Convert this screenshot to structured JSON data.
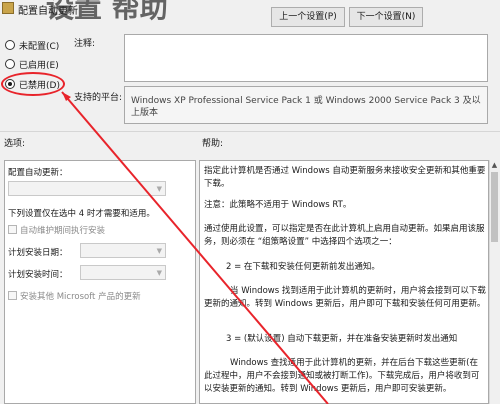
{
  "window": {
    "title": "配置自动更新",
    "title_big": "设置  帮助"
  },
  "nav": {
    "prev": "上一个设置(P)",
    "next": "下一个设置(N)"
  },
  "state": {
    "options": [
      {
        "label": "未配置(C)",
        "checked": false
      },
      {
        "label": "已启用(E)",
        "checked": false
      },
      {
        "label": "已禁用(D)",
        "checked": true
      }
    ]
  },
  "comment": {
    "label": "注释:",
    "value": ""
  },
  "supported": {
    "label": "支持的平台:",
    "value": "Windows XP Professional Service Pack 1 或 Windows 2000 Service Pack 3 及以上版本"
  },
  "options_section": {
    "heading": "选项:",
    "configure_label": "配置自动更新：",
    "configure_value": "",
    "note": "下列设置仅在选中 4 时才需要和适用。",
    "maintenance_cb": "自动维护期间执行安装",
    "schedule_day_label": "计划安装日期：",
    "schedule_time_label": "计划安装时间：",
    "other_products_cb": "安装其他 Microsoft 产品的更新"
  },
  "help_section": {
    "heading": "帮助:",
    "paragraphs": [
      "指定此计算机是否通过 Windows 自动更新服务来接收安全更新和其他重要下载。",
      "注意：此策略不适用于 Windows RT。",
      "通过使用此设置，可以指定是否在此计算机上启用自动更新。如果启用该服务，则必须在 “组策略设置” 中选择四个选项之一：",
      "2 = 在下载和安装任何更新前发出通知。",
      "当 Windows 找到适用于此计算机的更新时，用户将会接到可以下载更新的通知。转到 Windows 更新后，用户即可下载和安装任何可用更新。",
      "3 = (默认设置) 自动下载更新，并在准备安装更新时发出通知",
      "Windows 查找适用于此计算机的更新，并在后台下载这些更新(在此过程中，用户不会接到通知或被打断工作)。下载完成后，用户将收到可以安装更新的通知。转到 Windows 更新后，用户即可安装更新。"
    ]
  },
  "colors": {
    "annotation_red": "#e8242b"
  }
}
